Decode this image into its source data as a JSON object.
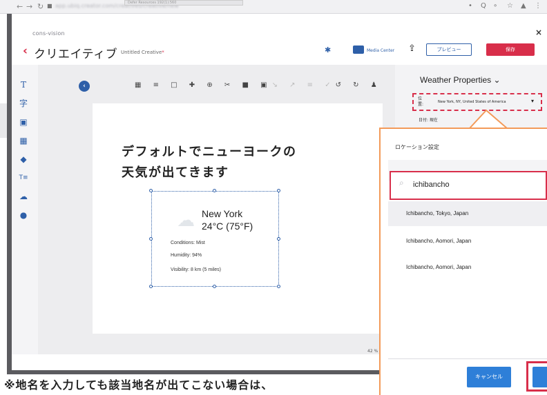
{
  "browser": {
    "back_icon": "←",
    "forward_icon": "→",
    "reload_icon": "↻",
    "lock_icon": "■",
    "url": "app.ubiq.creator.com/creatives/creative/new",
    "extensions": [
      "•",
      "Q",
      "∘",
      "☆",
      "▲",
      "⋮"
    ],
    "ghost_tab": "Defer Resources    192(1):560"
  },
  "app": {
    "brand": "cons-vision",
    "back_icon": "‹",
    "title": "クリエイティブ",
    "subtitle": "Untitled Creative",
    "subtitle_mark": "*",
    "gear_icon": "✱",
    "media_center": "Media Center",
    "upload_icon": "⇪",
    "preview_label": "プレビュー",
    "save_label": "保存",
    "close_icon": "×"
  },
  "sidebar": {
    "tools": [
      {
        "name": "text-tool-icon",
        "glyph": "T"
      },
      {
        "name": "text-box-tool-icon",
        "glyph": "字"
      },
      {
        "name": "image-tool-icon",
        "glyph": "▣"
      },
      {
        "name": "video-tool-icon",
        "glyph": "▦"
      },
      {
        "name": "shapes-tool-icon",
        "glyph": "◆"
      },
      {
        "name": "table-text-tool-icon",
        "glyph": "T≡"
      },
      {
        "name": "weather-tool-icon",
        "glyph": "☁"
      },
      {
        "name": "clock-tool-icon",
        "glyph": "●"
      }
    ]
  },
  "toolbar": {
    "left_toggle": "‹",
    "right_toggle": "›",
    "icons": "▦ ≡ □ ✚ ⊕ ✂ ■ ▣",
    "dim_icons": "↘ ↗ ≡ ✓",
    "tail_icons": "↺ ↻ ♟"
  },
  "canvas": {
    "zoom": "42 %"
  },
  "widget": {
    "city": "New York",
    "temperature": "24°C (75°F)",
    "conditions": "Conditions: Mist",
    "humidity": "Humidity: 94%",
    "visibility": "Visibility: 8 km (5 miles)",
    "cloud_icon": "☁"
  },
  "properties": {
    "title": "Weather Properties",
    "chevron": "⌄",
    "location_label": "位置:",
    "location_value": "New York, NY, United States of America",
    "pin_icon": "▾",
    "date_label": "日付:  現在"
  },
  "dialog": {
    "title": "ロケーション設定",
    "search_value": "ichibancho",
    "search_icon": "⌕",
    "results": [
      "Ichibancho, Tokyo, Japan",
      "Ichibancho, Aomori, Japan",
      "Ichibancho, Aomori, Japan"
    ],
    "cancel_label": "キャンセル"
  },
  "annotation": {
    "line1": "デフォルトでニューヨークの",
    "line2": "天気が出てきます",
    "footnote": "※地名を入力しても該当地名が出てこない場合は、"
  },
  "colors": {
    "accent_blue": "#2e5fa8",
    "brand_red": "#d82e4a",
    "callout_orange": "#f39a58",
    "button_blue": "#2e7fd8"
  }
}
